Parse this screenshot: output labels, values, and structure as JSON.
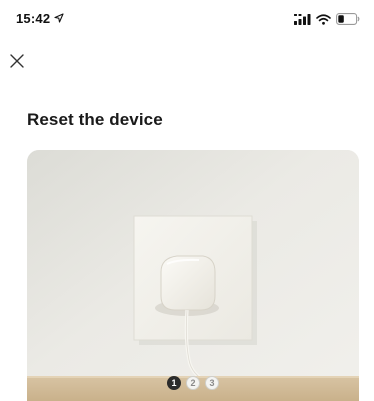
{
  "status_bar": {
    "time": "15:42",
    "icons": [
      "location-arrow-icon",
      "cellular-signal-icon",
      "wifi-icon",
      "battery-icon"
    ]
  },
  "header": {
    "close_icon": "close-icon"
  },
  "main": {
    "title": "Reset the device",
    "illustration": "device-plugged-into-wall-socket-image",
    "pager": [
      "1",
      "2",
      "3"
    ],
    "active_page": 1
  },
  "colors": {
    "background": "#ffffff",
    "text": "#1a1a1a",
    "pager_active": "#2b2b2b"
  }
}
